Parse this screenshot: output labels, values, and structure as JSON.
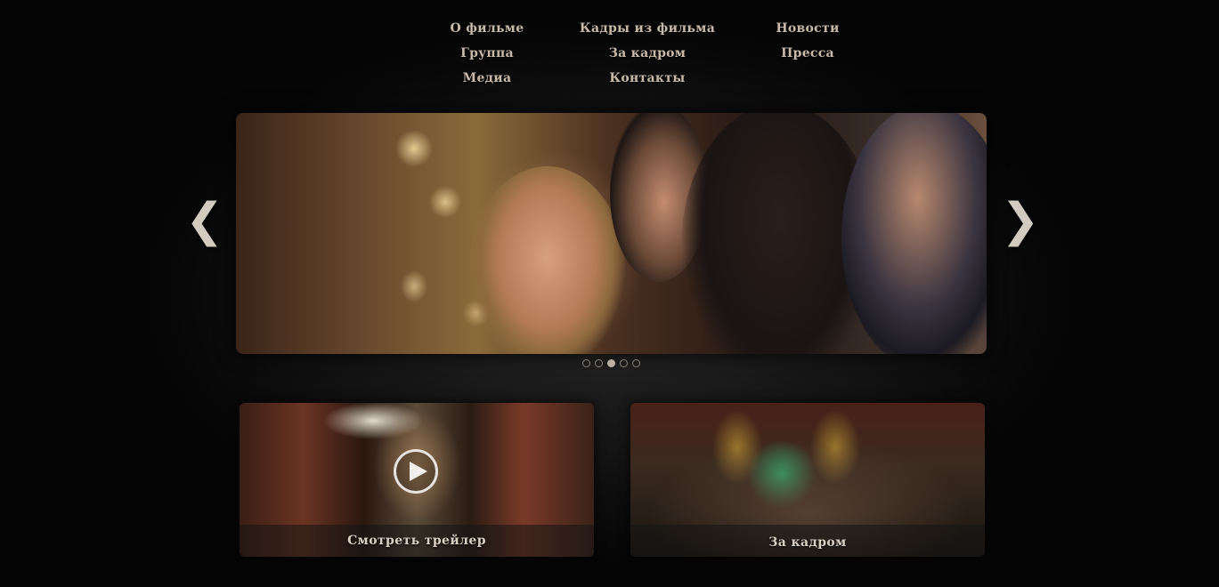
{
  "nav": {
    "items": [
      {
        "label": "О фильме"
      },
      {
        "label": "Кадры из фильма"
      },
      {
        "label": "Новости"
      },
      {
        "label": "Группа"
      },
      {
        "label": "За кадром"
      },
      {
        "label": "Пресса"
      },
      {
        "label": "Медиа"
      },
      {
        "label": "Контакты"
      }
    ]
  },
  "slider": {
    "prev_icon": "chevron-left-icon",
    "next_icon": "chevron-right-icon",
    "prev_glyph": "❮",
    "next_glyph": "❯",
    "slide_count": 5,
    "active_slide": 3
  },
  "tiles": {
    "trailer": {
      "label": "Смотреть трейлер",
      "icon": "play-icon"
    },
    "behind_scenes": {
      "label": "За кадром"
    }
  },
  "colors": {
    "nav_text": "#c8b9a8",
    "background": "#000000",
    "arrow": "#d4cbc0"
  }
}
